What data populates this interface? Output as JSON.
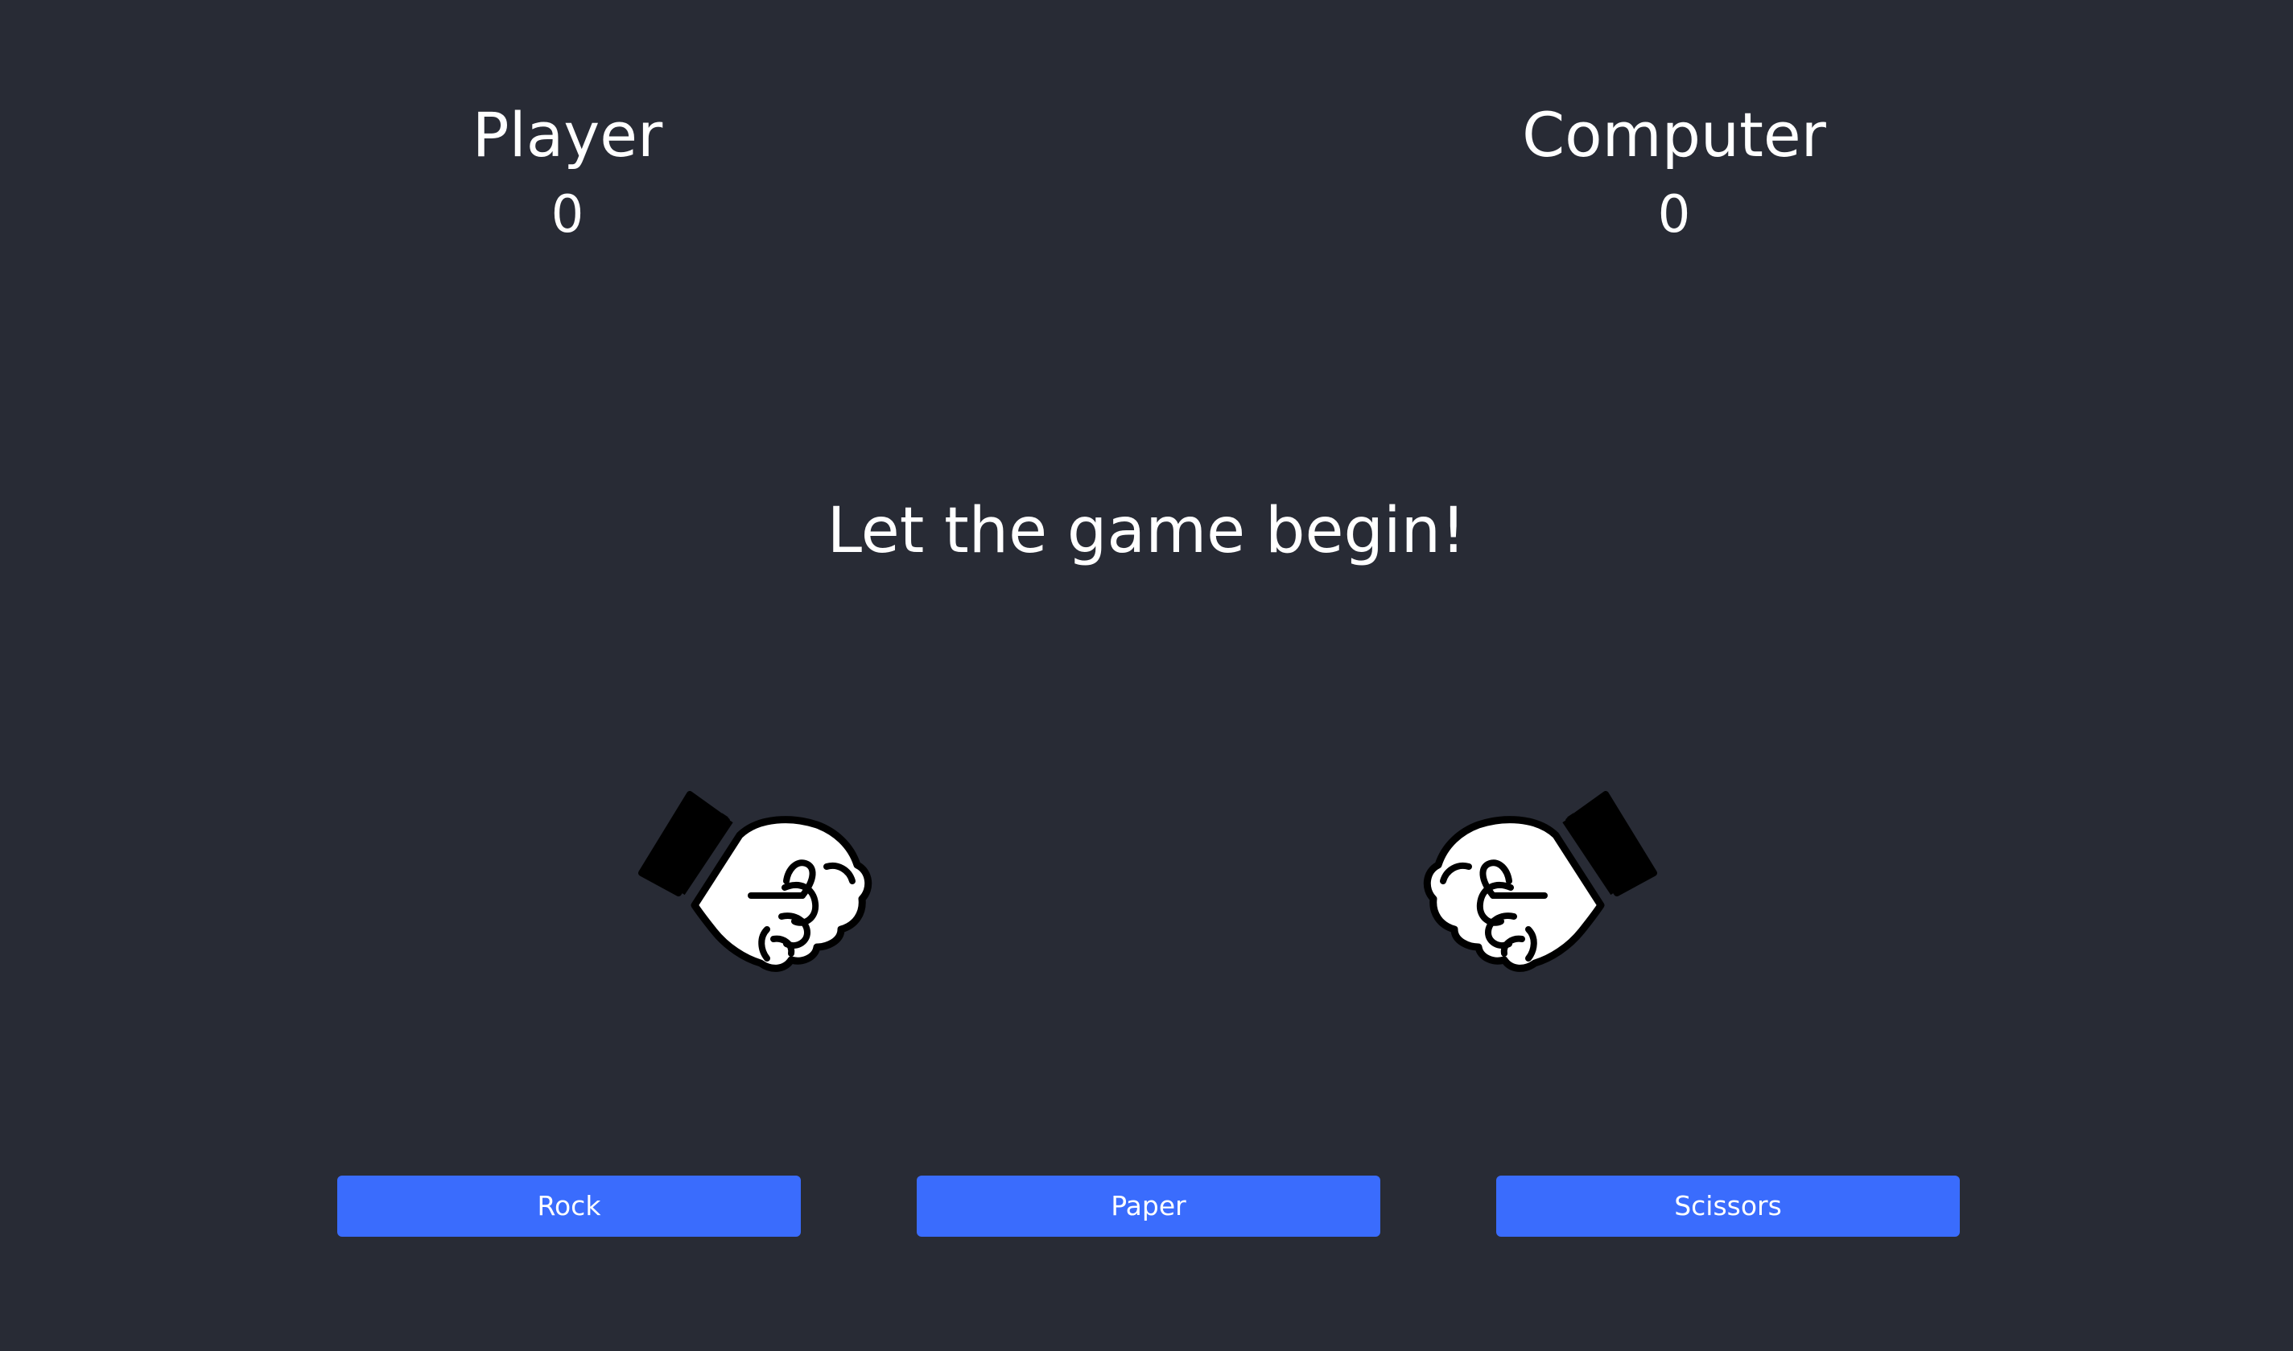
{
  "scoreboard": {
    "player_label": "Player",
    "player_score": "0",
    "computer_label": "Computer",
    "computer_score": "0"
  },
  "status_message": "Let the game begin!",
  "hands": {
    "player_icon": "fist-icon",
    "computer_icon": "fist-icon"
  },
  "choices": {
    "rock_label": "Rock",
    "paper_label": "Paper",
    "scissors_label": "Scissors"
  },
  "colors": {
    "background": "#282b35",
    "button": "#3a6cfd",
    "text": "#ffffff"
  }
}
